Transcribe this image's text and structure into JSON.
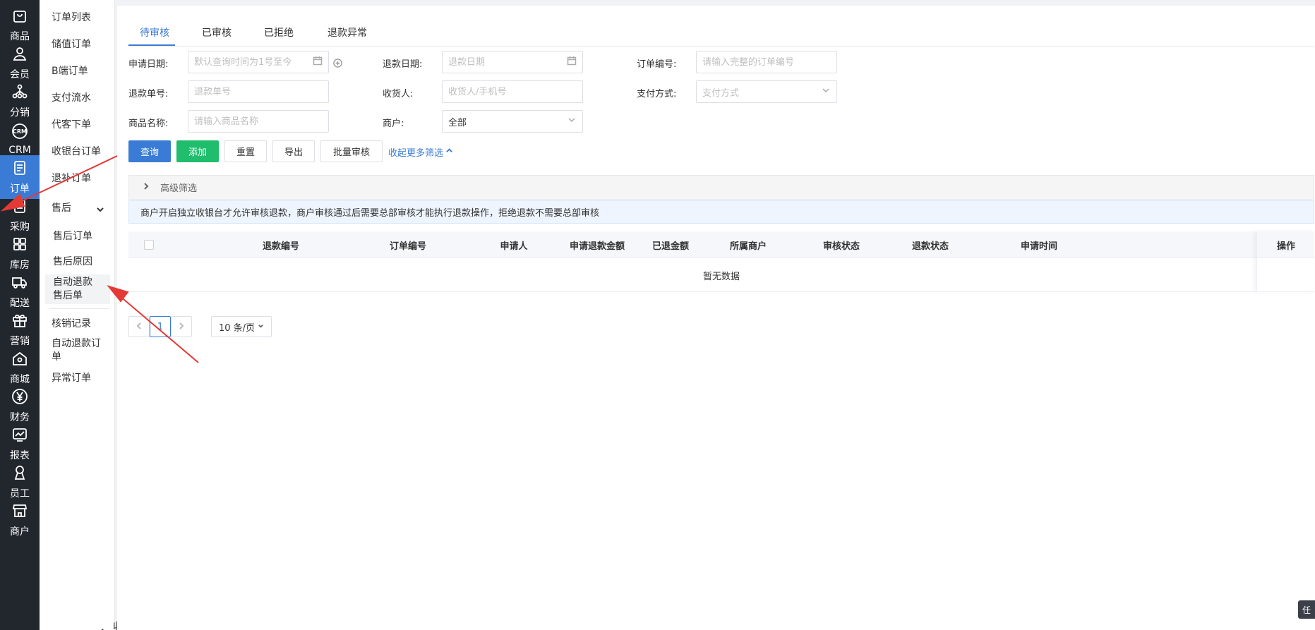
{
  "nav": {
    "items": [
      {
        "label": "商品",
        "icon": "bag-icon"
      },
      {
        "label": "会员",
        "icon": "user-icon"
      },
      {
        "label": "分销",
        "icon": "network-icon"
      },
      {
        "label": "CRM",
        "icon": "crm-icon"
      },
      {
        "label": "订单",
        "icon": "order-icon"
      },
      {
        "label": "采购",
        "icon": "clipboard-icon"
      },
      {
        "label": "库房",
        "icon": "grid-icon"
      },
      {
        "label": "配送",
        "icon": "truck-icon"
      },
      {
        "label": "营销",
        "icon": "gift-icon"
      },
      {
        "label": "商城",
        "icon": "home-icon"
      },
      {
        "label": "财务",
        "icon": "yen-icon"
      },
      {
        "label": "报表",
        "icon": "chart-icon"
      },
      {
        "label": "员工",
        "icon": "person-icon"
      },
      {
        "label": "商户",
        "icon": "store-icon"
      }
    ],
    "crm_badge": "CRM"
  },
  "subnav": {
    "items": [
      "订单列表",
      "储值订单",
      "B端订单",
      "支付流水",
      "代客下单",
      "收银台订单",
      "退补订单"
    ],
    "group": "售后",
    "children": [
      "售后订单",
      "售后原因",
      "自动退款售后单"
    ],
    "after": [
      "核销记录",
      "自动退款订单",
      "异常订单"
    ],
    "collapse": "收起"
  },
  "tabs": [
    "待审核",
    "已审核",
    "已拒绝",
    "退款异常"
  ],
  "filters": {
    "apply_date_label": "申请日期:",
    "apply_date_ph": "默认查询时间为1号至今",
    "refund_date_label": "退款日期:",
    "refund_date_ph": "退款日期",
    "order_no_label": "订单编号:",
    "order_no_ph": "请输入完整的订单编号",
    "refund_no_label": "退款单号:",
    "refund_no_ph": "退款单号",
    "receiver_label": "收货人:",
    "receiver_ph": "收货人/手机号",
    "pay_label": "支付方式:",
    "pay_ph": "支付方式",
    "goods_label": "商品名称:",
    "goods_ph": "请输入商品名称",
    "merchant_label": "商户:",
    "merchant_value": "全部"
  },
  "buttons": {
    "query": "查询",
    "add": "添加",
    "reset": "重置",
    "export": "导出",
    "batch": "批量审核",
    "more": "收起更多筛选"
  },
  "advanced": "高级筛选",
  "notice": "商户开启独立收银台才允许审核退款，商户审核通过后需要总部审核才能执行退款操作，拒绝退款不需要总部审核",
  "table": {
    "headers": [
      "退款编号",
      "订单编号",
      "申请人",
      "申请退款金额",
      "已退金额",
      "所属商户",
      "审核状态",
      "退款状态",
      "申请时间",
      "操作"
    ],
    "empty": "暂无数据"
  },
  "pager": {
    "current": "1",
    "size": "10 条/页"
  },
  "corner": "任"
}
